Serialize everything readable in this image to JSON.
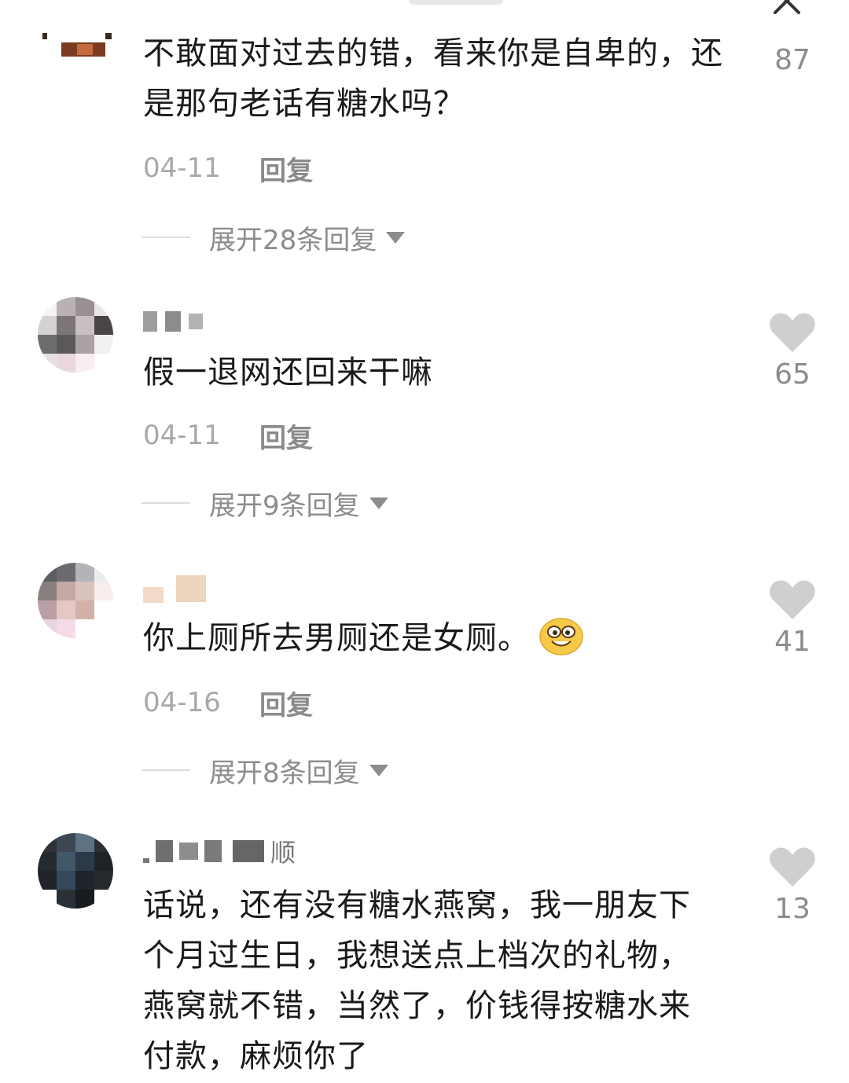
{
  "comments": [
    {
      "text": "不敢面对过去的错，看来你是自卑的，还是那句老话有糖水吗？",
      "date": "04-11",
      "reply_label": "回复",
      "expand_label": "展开28条回复",
      "likes": "87"
    },
    {
      "text": "假一退网还回来干嘛",
      "date": "04-11",
      "reply_label": "回复",
      "expand_label": "展开9条回复",
      "likes": "65"
    },
    {
      "text": "你上厕所去男厕还是女厕。",
      "date": "04-16",
      "reply_label": "回复",
      "expand_label": "展开8条回复",
      "likes": "41",
      "emoji": "grinning-emoji"
    },
    {
      "username_visible": "顺",
      "text": "话说，还有没有糖水燕窝，我一朋友下个月过生日，我想送点上档次的礼物，燕窝就不错，当然了，价钱得按糖水来付款，麻烦你了",
      "likes": "13"
    }
  ],
  "icons": {
    "close": "close-icon",
    "like": "heart-icon",
    "expand": "triangle-down-icon"
  },
  "colors": {
    "heart": "#cfcfcf",
    "meta_text": "#a8a8a8",
    "body_text": "#1a1a1a"
  }
}
